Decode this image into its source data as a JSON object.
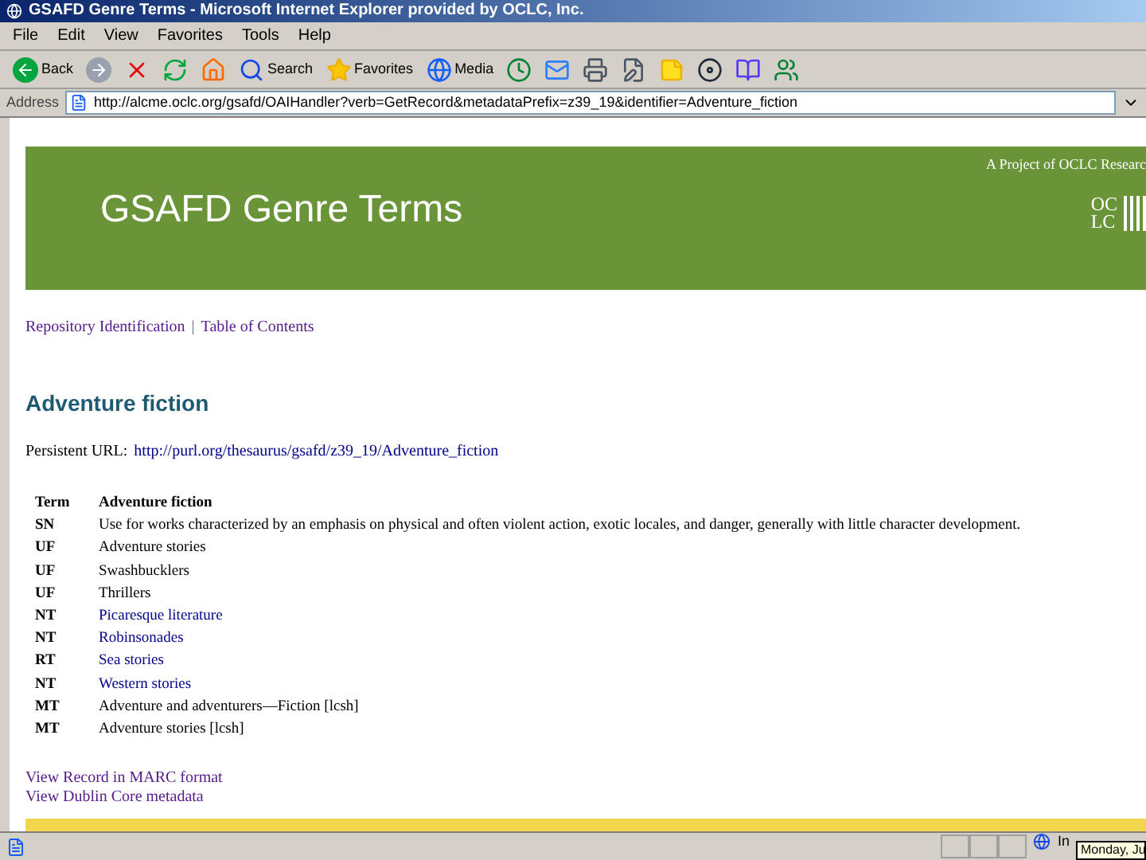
{
  "window": {
    "title": "GSAFD Genre Terms - Microsoft Internet Explorer provided by OCLC, Inc."
  },
  "menu": [
    "File",
    "Edit",
    "View",
    "Favorites",
    "Tools",
    "Help"
  ],
  "toolbar": [
    {
      "kind": "back",
      "label": "Back"
    },
    {
      "kind": "forward"
    },
    {
      "kind": "stop"
    },
    {
      "kind": "refresh"
    },
    {
      "kind": "home"
    },
    {
      "kind": "search",
      "label": "Search"
    },
    {
      "kind": "favorites",
      "label": "Favorites"
    },
    {
      "kind": "media",
      "label": "Media"
    },
    {
      "kind": "history"
    },
    {
      "kind": "mail"
    },
    {
      "kind": "print"
    },
    {
      "kind": "edit"
    },
    {
      "kind": "note"
    },
    {
      "kind": "reel"
    },
    {
      "kind": "book"
    },
    {
      "kind": "messenger"
    }
  ],
  "address": {
    "label": "Address",
    "value": "http://alcme.oclc.org/gsafd/OAIHandler?verb=GetRecord&metadataPrefix=z39_19&identifier=Adventure_fiction"
  },
  "header": {
    "title": "GSAFD Genre Terms",
    "tagline": "A Project of OCLC Researc",
    "logo_top": "OC",
    "logo_bottom": "LC"
  },
  "nav_links": [
    "Repository Identification",
    "Table of Contents"
  ],
  "nav_separator": "|",
  "heading": "Adventure fiction",
  "persistent_url": {
    "label": "Persistent URL:",
    "url": "http://purl.org/thesaurus/gsafd/z39_19/Adventure_fiction"
  },
  "table": {
    "columns": [
      "Term",
      "Adventure fiction"
    ],
    "rows": [
      {
        "tag": "SN",
        "text": "Use for works characterized by an emphasis on physical and often violent action, exotic locales, and danger, generally with little character development.",
        "link": false
      },
      {
        "tag": "UF",
        "text": "Adventure stories",
        "link": false
      },
      {
        "tag": "UF",
        "text": "Swashbucklers",
        "link": false
      },
      {
        "tag": "UF",
        "text": "Thrillers",
        "link": false
      },
      {
        "tag": "NT",
        "text": "Picaresque literature",
        "link": true
      },
      {
        "tag": "NT",
        "text": "Robinsonades",
        "link": true
      },
      {
        "tag": "RT",
        "text": "Sea stories",
        "link": true
      },
      {
        "tag": "NT",
        "text": "Western stories",
        "link": true
      },
      {
        "tag": "MT",
        "text": "Adventure and adventurers—Fiction [lcsh]",
        "link": false
      },
      {
        "tag": "MT",
        "text": "Adventure stories [lcsh]",
        "link": false
      }
    ]
  },
  "footer_links": [
    "View Record in MARC format",
    "View Dublin Core metadata"
  ],
  "status_bar": {
    "zone": "In",
    "tooltip": "Monday, Ju"
  }
}
